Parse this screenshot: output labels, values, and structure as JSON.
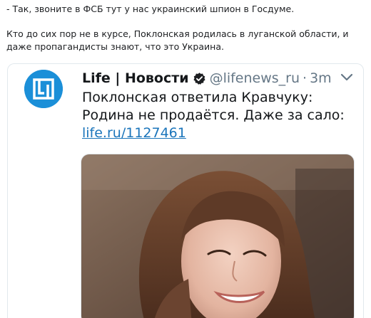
{
  "post": {
    "line1": "- Так, звоните в ФСБ тут у нас украинский шпион в Госдуме.",
    "line2": "Кто до сих пор не в курсе, Поклонская родилась в луганской области, и даже пропагандисты знают, что это Украина."
  },
  "tweet": {
    "account_name": "Life | Новости",
    "handle": "@lifenews_ru",
    "separator": "·",
    "time": "3m",
    "text_line1": "Поклонская ответила Кравчуку:",
    "text_line2": "Родина не продаётся. Даже за сало:",
    "link": "life.ru/1127461",
    "avatar_icon": "lifenews-logo",
    "verified_icon": "verified-badge-icon",
    "menu_icon": "chevron-down-icon"
  },
  "colors": {
    "brand_blue": "#1b8fd8",
    "link": "#1b75bb",
    "muted": "#657786",
    "text": "#14171a"
  }
}
